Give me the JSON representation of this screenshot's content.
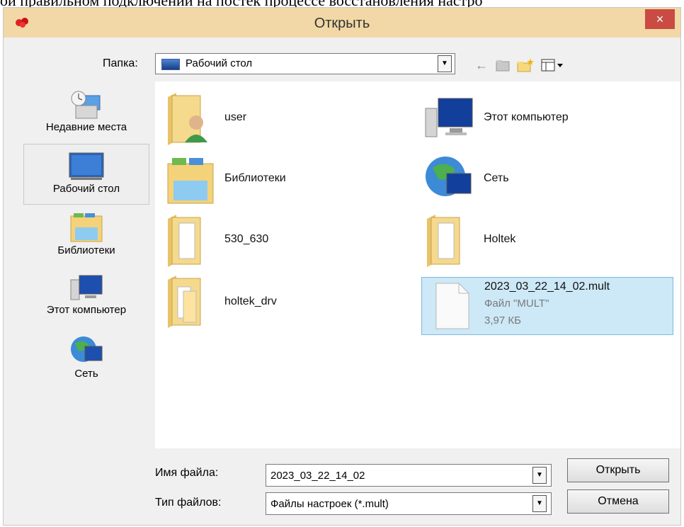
{
  "background_text": "ой правильном подключении на постек процессе восстановления настро",
  "window": {
    "title": "Открыть",
    "close": "×"
  },
  "toolbar": {
    "folder_label": "Папка:",
    "folder_value": "Рабочий стол"
  },
  "places": [
    {
      "label": "Недавние места",
      "icon": "recent-places-icon"
    },
    {
      "label": "Рабочий стол",
      "icon": "desktop-icon",
      "selected": true
    },
    {
      "label": "Библиотеки",
      "icon": "libraries-icon"
    },
    {
      "label": "Этот компьютер",
      "icon": "computer-icon"
    },
    {
      "label": "Сеть",
      "icon": "network-icon"
    }
  ],
  "files": [
    {
      "name": "user",
      "icon": "user-folder-icon"
    },
    {
      "name": "Этот компьютер",
      "icon": "computer-icon"
    },
    {
      "name": "Библиотеки",
      "icon": "libraries-icon"
    },
    {
      "name": "Сеть",
      "icon": "network-icon"
    },
    {
      "name": "530_630",
      "icon": "folder-icon"
    },
    {
      "name": "Holtek",
      "icon": "folder-icon"
    },
    {
      "name": "holtek_drv",
      "icon": "folder-icon"
    },
    {
      "name": "2023_03_22_14_02.mult",
      "type": "Файл \"MULT\"",
      "size": "3,97 КБ",
      "icon": "file-icon",
      "selected": true
    }
  ],
  "footer": {
    "filename_label": "Имя файла:",
    "filename_value": "2023_03_22_14_02",
    "filetype_label": "Тип файлов:",
    "filetype_value": "Файлы настроек (*.mult)",
    "open_button": "Открыть",
    "cancel_button": "Отмена"
  }
}
